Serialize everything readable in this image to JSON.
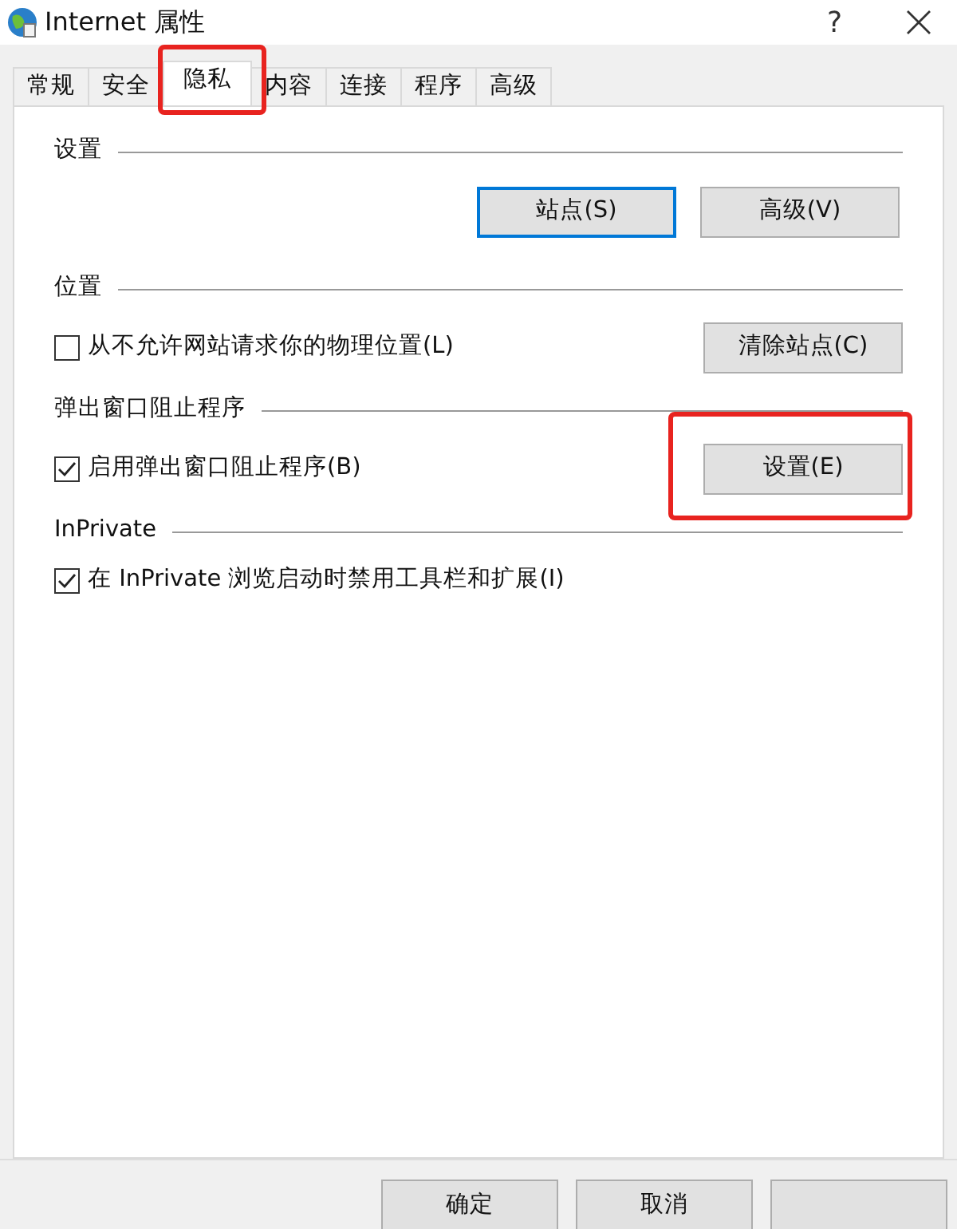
{
  "window": {
    "title": "Internet 属性",
    "help": "?"
  },
  "tabs": [
    {
      "label": "常规",
      "selected": false,
      "highlighted": false
    },
    {
      "label": "安全",
      "selected": false,
      "highlighted": false
    },
    {
      "label": "隐私",
      "selected": true,
      "highlighted": true
    },
    {
      "label": "内容",
      "selected": false,
      "highlighted": false
    },
    {
      "label": "连接",
      "selected": false,
      "highlighted": false
    },
    {
      "label": "程序",
      "selected": false,
      "highlighted": false
    },
    {
      "label": "高级",
      "selected": false,
      "highlighted": false
    }
  ],
  "sections": [
    {
      "title": "设置",
      "rows": [
        {
          "kind": "buttons",
          "buttons": [
            {
              "label": "站点(S)",
              "focused": true,
              "highlighted": false
            },
            {
              "label": "高级(V)",
              "focused": false,
              "highlighted": false
            }
          ]
        }
      ]
    },
    {
      "title": "位置",
      "rows": [
        {
          "kind": "checkbox",
          "label": "从不允许网站请求你的物理位置(L)",
          "checked": false,
          "button": {
            "label": "清除站点(C)",
            "focused": false,
            "highlighted": false
          }
        }
      ]
    },
    {
      "title": "弹出窗口阻止程序",
      "rows": [
        {
          "kind": "checkbox",
          "label": "启用弹出窗口阻止程序(B)",
          "checked": true,
          "button": {
            "label": "设置(E)",
            "focused": false,
            "highlighted": true
          }
        }
      ]
    },
    {
      "title": "InPrivate",
      "rows": [
        {
          "kind": "checkbox",
          "label": "在 InPrivate 浏览启动时禁用工具栏和扩展(I)",
          "checked": true
        }
      ]
    }
  ],
  "footer": {
    "buttons": [
      {
        "kind": "labeled",
        "label": "确定"
      },
      {
        "kind": "labeled",
        "label": "取消"
      },
      {
        "kind": "hidden-label"
      }
    ]
  }
}
